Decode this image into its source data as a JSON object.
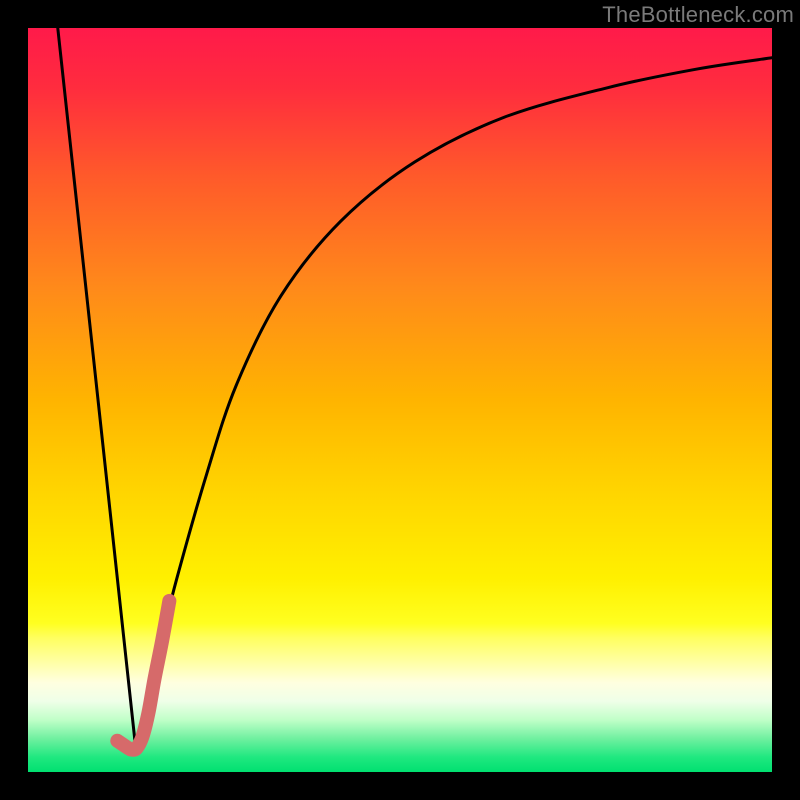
{
  "watermark": {
    "text": "TheBottleneck.com"
  },
  "colors": {
    "frame": "#000000",
    "gradient_stops": [
      {
        "offset": 0.0,
        "color": "#ff1a4a"
      },
      {
        "offset": 0.08,
        "color": "#ff2c3e"
      },
      {
        "offset": 0.2,
        "color": "#ff5a2a"
      },
      {
        "offset": 0.35,
        "color": "#ff8a1a"
      },
      {
        "offset": 0.5,
        "color": "#ffb400"
      },
      {
        "offset": 0.62,
        "color": "#ffd400"
      },
      {
        "offset": 0.74,
        "color": "#fff000"
      },
      {
        "offset": 0.8,
        "color": "#ffff20"
      },
      {
        "offset": 0.82,
        "color": "#ffff60"
      },
      {
        "offset": 0.85,
        "color": "#ffffa0"
      },
      {
        "offset": 0.88,
        "color": "#ffffe0"
      },
      {
        "offset": 0.905,
        "color": "#efffe8"
      },
      {
        "offset": 0.93,
        "color": "#c0ffc8"
      },
      {
        "offset": 0.955,
        "color": "#70f0a0"
      },
      {
        "offset": 0.98,
        "color": "#20e880"
      },
      {
        "offset": 1.0,
        "color": "#00e070"
      }
    ],
    "curve": "#000000",
    "accent": "#d66a6a"
  },
  "chart_data": {
    "type": "line",
    "title": "",
    "xlabel": "",
    "ylabel": "",
    "xlim": [
      0,
      100
    ],
    "ylim": [
      0,
      100
    ],
    "grid": false,
    "series": [
      {
        "name": "left-arm",
        "x": [
          4,
          14.5
        ],
        "values": [
          100,
          3
        ]
      },
      {
        "name": "right-arm",
        "x": [
          14.5,
          16,
          18,
          20,
          24,
          28,
          34,
          42,
          52,
          64,
          78,
          90,
          100
        ],
        "values": [
          3,
          10,
          18,
          26,
          40,
          52,
          64,
          74,
          82,
          88,
          92,
          94.5,
          96
        ]
      }
    ],
    "accent_segment": {
      "name": "J-hook",
      "x": [
        12.0,
        13.5,
        14.0,
        14.6,
        15.4,
        16.2,
        17.0,
        18.0,
        19.0
      ],
      "values": [
        4.2,
        3.2,
        3.0,
        3.2,
        4.8,
        8.0,
        12.5,
        17.5,
        23.0
      ]
    }
  }
}
